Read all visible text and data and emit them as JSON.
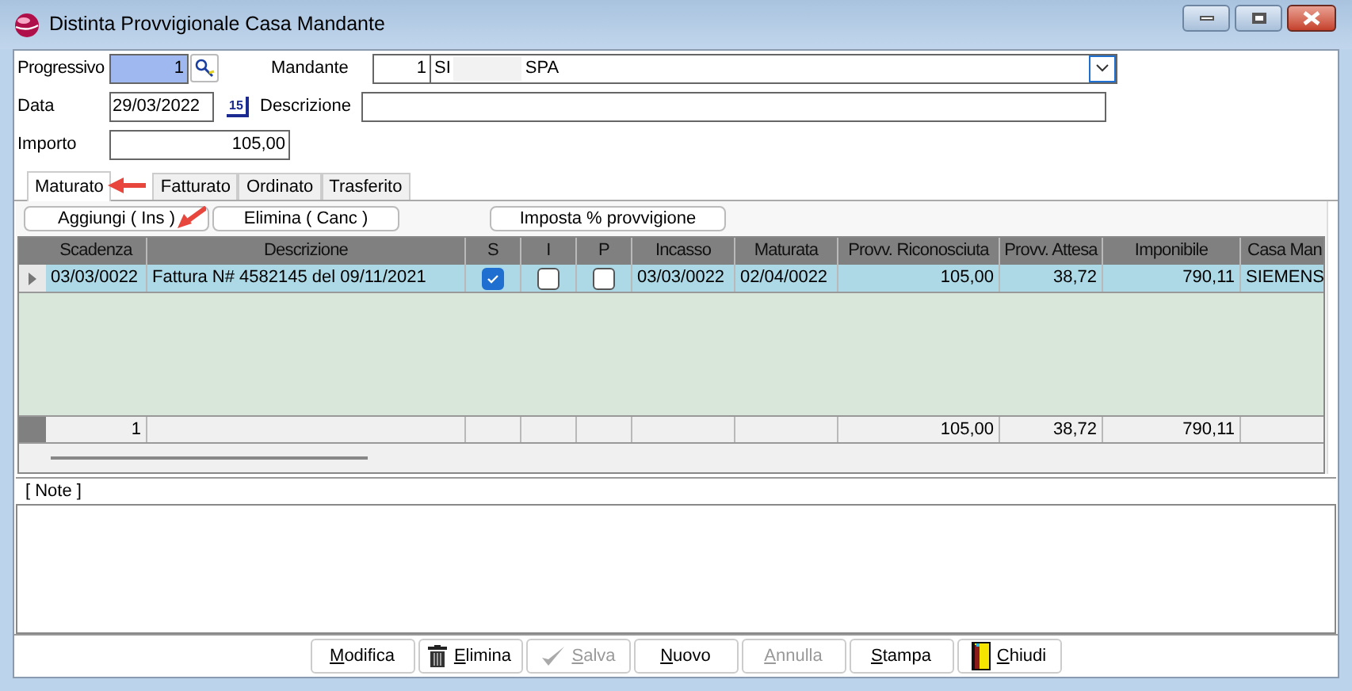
{
  "window": {
    "title": "Distinta Provvigionale Casa Mandante"
  },
  "form": {
    "progressivo": {
      "label": "Progressivo",
      "value": "1"
    },
    "mandante": {
      "label": "Mandante",
      "code": "1",
      "name_start": "SI",
      "name_end": "SPA"
    },
    "data": {
      "label": "Data",
      "value": "29/03/2022",
      "calendar_day": "15"
    },
    "descrizione": {
      "label": "Descrizione"
    },
    "importo": {
      "label": "Importo",
      "value": "105,00"
    }
  },
  "tabs": [
    {
      "label": "Maturato",
      "selected": true
    },
    {
      "label": "Fatturato",
      "selected": false
    },
    {
      "label": "Ordinato",
      "selected": false
    },
    {
      "label": "Trasferito",
      "selected": false
    }
  ],
  "toolbar": [
    "Aggiungi ( Ins )",
    "Elimina ( Canc )",
    "Imposta % provvigione"
  ],
  "table": {
    "columns": [
      "Scadenza",
      "Descrizione",
      "S",
      "I",
      "P",
      "Incasso",
      "Maturata",
      "Provv. Riconosciuta",
      "Provv. Attesa",
      "Imponibile",
      "Casa Man"
    ],
    "rows": [
      {
        "current": true,
        "scadenza": "03/03/0022",
        "descrizione": "Fattura N# 4582145 del 09/11/2021",
        "s": true,
        "i": false,
        "p": false,
        "incasso": "03/03/0022",
        "maturata": "02/04/0022",
        "provv_ric": "105,00",
        "provv_att": "38,72",
        "imponibile": "790,11",
        "casa": "SIEMENS"
      }
    ],
    "totals": {
      "count": "1",
      "provv_ric": "105,00",
      "provv_att": "38,72",
      "imponibile": "790,11"
    }
  },
  "note": {
    "label": "[ Note ]"
  },
  "buttons": [
    {
      "accel": "M",
      "rest": "odifica",
      "disabled": false,
      "kind": "plain"
    },
    {
      "accel": "E",
      "rest": "limina",
      "disabled": false,
      "kind": "delete"
    },
    {
      "accel": "S",
      "rest": "alva",
      "disabled": true,
      "kind": "save"
    },
    {
      "accel": "N",
      "rest": "uovo",
      "disabled": false,
      "kind": "plain"
    },
    {
      "accel": "A",
      "rest": "nnulla",
      "disabled": true,
      "kind": "plain"
    },
    {
      "accel": "S",
      "rest": "tampa",
      "disabled": false,
      "kind": "plain"
    },
    {
      "accel": "C",
      "rest": "hiudi",
      "disabled": false,
      "kind": "exit"
    }
  ]
}
